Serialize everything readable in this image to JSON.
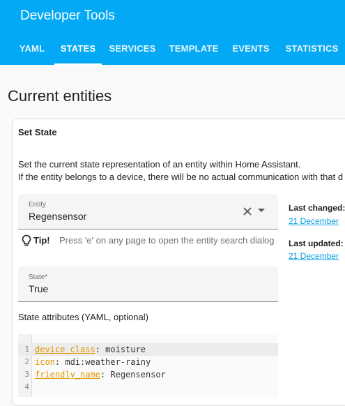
{
  "header": {
    "title": "Developer Tools",
    "tabs": [
      {
        "label": "YAML"
      },
      {
        "label": "STATES"
      },
      {
        "label": "SERVICES"
      },
      {
        "label": "TEMPLATE"
      },
      {
        "label": "EVENTS"
      },
      {
        "label": "STATISTICS"
      }
    ],
    "active_tab": "STATES"
  },
  "page": {
    "title": "Current entities"
  },
  "set_state": {
    "header": "Set State",
    "description_line1": "Set the current state representation of an entity within Home Assistant.",
    "description_line2": "If the entity belongs to a device, there will be no actual communication with that d",
    "entity_field": {
      "label": "Entity",
      "value": "Regensensor"
    },
    "tip": {
      "bold": "Tip!",
      "text": "Press 'e' on any page to open the entity search dialog"
    },
    "state_field": {
      "label": "State*",
      "value": "True"
    },
    "attributes_label": "State attributes (YAML, optional)",
    "yaml_lines": [
      {
        "num": "1",
        "key": "device_class",
        "sep": ": ",
        "value": "moisture"
      },
      {
        "num": "2",
        "key": "icon",
        "sep": ": ",
        "value": "mdi:weather-rainy"
      },
      {
        "num": "3",
        "key": "friendly_name",
        "sep": ": ",
        "value": "Regensensor"
      },
      {
        "num": "4",
        "key": "",
        "sep": "",
        "value": ""
      }
    ]
  },
  "side_info": {
    "last_changed_label": "Last changed:",
    "last_changed_value": "21 December",
    "last_updated_label": "Last updated:",
    "last_updated_value": "21 December"
  },
  "colors": {
    "app_bar": "#03a9f4",
    "link": "#039be5",
    "yaml_key": "#e09400"
  }
}
